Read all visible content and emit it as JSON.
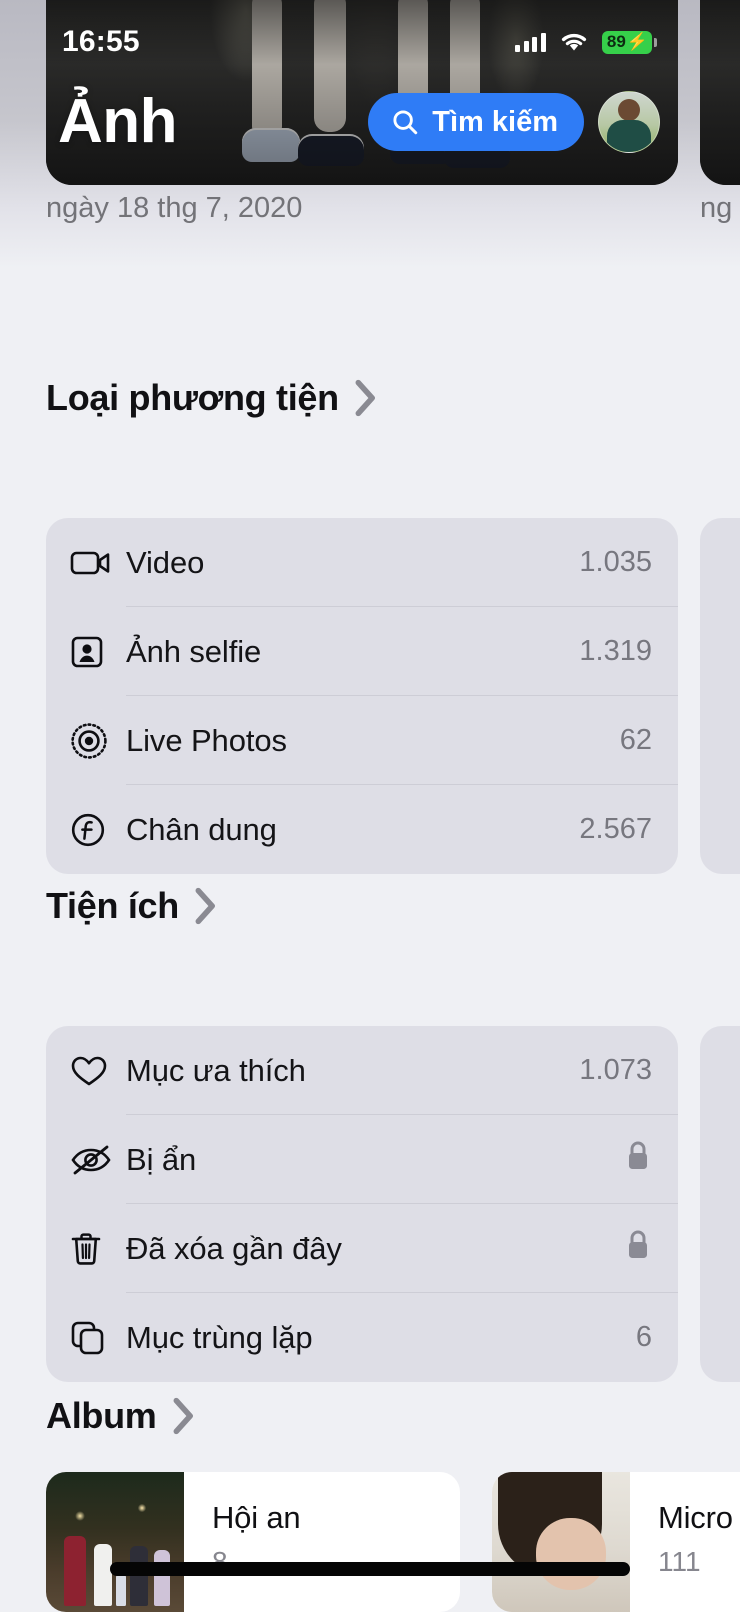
{
  "status_bar": {
    "time": "16:55",
    "cellular_icon": "cellular-bars-icon",
    "wifi_icon": "wifi-icon",
    "battery_level": "89",
    "battery_charging_glyph": "⚡",
    "battery_color": "#36d04a"
  },
  "header": {
    "app_title": "Ảnh",
    "search_label": "Tìm kiếm",
    "search_icon": "search-icon",
    "search_pill_color": "#2f7cf6",
    "avatar_name": "avatar",
    "date_primary": "ngày 18 thg 7, 2020",
    "date_secondary": "ng"
  },
  "sections": [
    {
      "title": "Loại phương tiện",
      "chevron": "chevron-right-icon",
      "rows": [
        {
          "icon": "video-camera-icon",
          "label": "Video",
          "value": "1.035"
        },
        {
          "icon": "person-square-icon",
          "label": "Ảnh selfie",
          "value": "1.319"
        },
        {
          "icon": "live-photo-icon",
          "label": "Live Photos",
          "value": "62"
        },
        {
          "icon": "f-stop-circle-icon",
          "label": "Chân dung",
          "value": "2.567"
        }
      ]
    },
    {
      "title": "Tiện ích",
      "chevron": "chevron-right-icon",
      "rows": [
        {
          "icon": "heart-icon",
          "label": "Mục ưa thích",
          "value": "1.073"
        },
        {
          "icon": "eye-slash-icon",
          "label": "Bị ẩn",
          "value": "",
          "lock": true
        },
        {
          "icon": "trash-icon",
          "label": "Đã xóa gần đây",
          "value": "",
          "lock": true
        },
        {
          "icon": "duplicate-icon",
          "label": "Mục trùng lặp",
          "value": "6"
        }
      ]
    }
  ],
  "album_section": {
    "title": "Album",
    "chevron": "chevron-right-icon",
    "albums": [
      {
        "name": "Hội an",
        "count": "8",
        "thumb": "street-night-thumb"
      },
      {
        "name": "Micro",
        "count": "111",
        "thumb": "baby-portrait-thumb"
      }
    ]
  },
  "home_indicator": "home-indicator"
}
